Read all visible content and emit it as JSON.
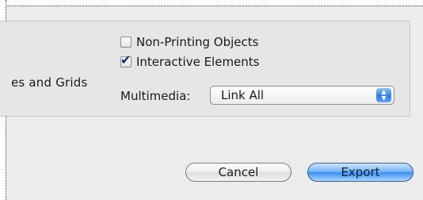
{
  "options": {
    "truncated_label": "es and Grids",
    "non_printing_objects": {
      "label": "Non-Printing Objects",
      "checked": false
    },
    "interactive_elements": {
      "label": "Interactive Elements",
      "checked": true
    },
    "multimedia": {
      "label": "Multimedia:",
      "value": "Link All"
    }
  },
  "buttons": {
    "cancel": "Cancel",
    "export": "Export"
  },
  "icons": {
    "checkmark": "checkmark-icon",
    "popup_arrows": "updown-arrows-icon"
  }
}
